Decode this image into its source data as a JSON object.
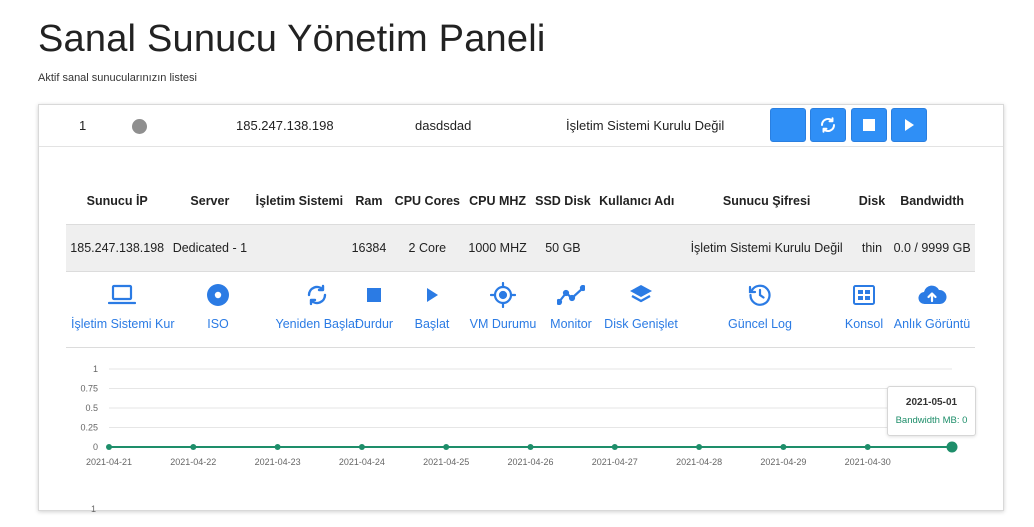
{
  "page": {
    "title": "Sanal Sunucu Yönetim Paneli",
    "subtitle": "Aktif sanal sunucularınızın listesi"
  },
  "server": {
    "index": "1",
    "ip": "185.247.138.198",
    "name": "dasdsdad",
    "os_status": "İşletim Sistemi Kurulu Değil",
    "status_color": "#8f8f8f"
  },
  "header_buttons": [
    {
      "icon": "blank"
    },
    {
      "icon": "restart-icon"
    },
    {
      "icon": "stop-icon"
    },
    {
      "icon": "play-icon"
    }
  ],
  "specs": {
    "headers": [
      "Sunucu İP",
      "Server",
      "İşletim Sistemi",
      "Ram",
      "CPU Cores",
      "CPU MHZ",
      "SSD Disk",
      "Kullanıcı Adı",
      "Sunucu Şifresi",
      "Disk",
      "Bandwidth"
    ],
    "row": [
      "185.247.138.198",
      "Dedicated - 1",
      "",
      "16384",
      "2 Core",
      "1000 MHZ",
      "50 GB",
      "",
      "İşletim Sistemi Kurulu Değil",
      "thin",
      "0.0 / 9999 GB"
    ]
  },
  "actions": [
    {
      "label": "İşletim Sistemi Kur",
      "icon": "laptop-icon"
    },
    {
      "label": "ISO",
      "icon": "disc-icon"
    },
    {
      "label": "Yeniden Başlat",
      "icon": "restart-icon"
    },
    {
      "label": "Durdur",
      "icon": "stop-icon"
    },
    {
      "label": "Başlat",
      "icon": "play-icon"
    },
    {
      "label": "VM Durumu",
      "icon": "crosshair-icon"
    },
    {
      "label": "Monitor",
      "icon": "chart-line-icon"
    },
    {
      "label": "Disk Genişlet",
      "icon": "layers-icon"
    },
    {
      "label": "Güncel Log",
      "icon": "history-icon"
    },
    {
      "label": "Konsol",
      "icon": "console-icon"
    },
    {
      "label": "Anlık Görüntü",
      "icon": "cloud-upload-icon"
    }
  ],
  "colors": {
    "accent": "#2f8ff6",
    "link": "#2b7be4",
    "series": "#1e8e6a"
  },
  "chart_data": {
    "type": "line",
    "x": [
      "2021-04-21",
      "2021-04-22",
      "2021-04-23",
      "2021-04-24",
      "2021-04-25",
      "2021-04-26",
      "2021-04-27",
      "2021-04-28",
      "2021-04-29",
      "2021-04-30",
      "2021-05-01"
    ],
    "series": [
      {
        "name": "Bandwidth MB",
        "values": [
          0,
          0,
          0,
          0,
          0,
          0,
          0,
          0,
          0,
          0,
          0
        ]
      }
    ],
    "y_ticks": [
      "1",
      "0.75",
      "0.5",
      "0.25",
      "0"
    ],
    "ylim": [
      0,
      1
    ],
    "grid": true,
    "tooltip": {
      "date": "2021-05-01",
      "text": "Bandwidth MB: 0"
    }
  },
  "second_chart": {
    "y_tick_top": "1"
  }
}
